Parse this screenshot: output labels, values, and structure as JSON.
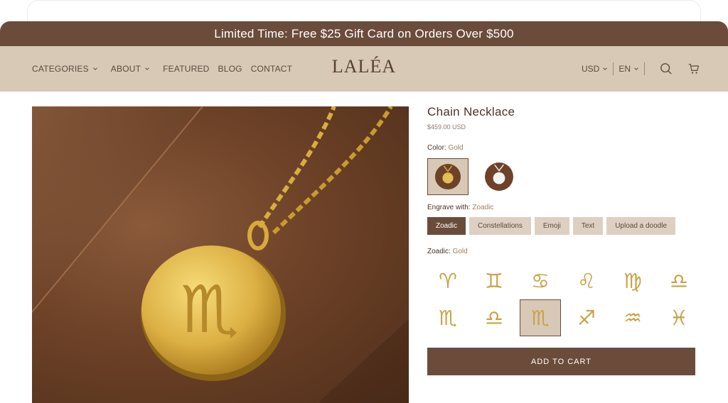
{
  "announcement": "Limited Time: Free $25 Gift Card on Orders Over $500",
  "nav": {
    "categories": "CATEGORIES",
    "about": "ABOUT",
    "featured": "FEATURED",
    "blog": "BLOG",
    "contact": "CONTACT"
  },
  "brand": "LALÉA",
  "currency": "USD",
  "language": "EN",
  "product": {
    "title": "Chain Necklace",
    "price": "$459.00 USD"
  },
  "color_option": {
    "label": "Color:",
    "value": "Gold"
  },
  "engrave_option": {
    "label": "Engrave with:",
    "value": "Zoadic",
    "choices": [
      "Zoadic",
      "Constellations",
      "Emoji",
      "Text",
      "Upload a doodle"
    ]
  },
  "zodiac_option": {
    "label": "Zoadic:",
    "value": "Gold",
    "symbols": [
      "♈",
      "♊",
      "♋",
      "♌",
      "♍",
      "♎",
      "♏",
      "♎",
      "♏",
      "♐",
      "♒",
      "♓"
    ]
  },
  "add_to_cart": "ADD TO CART",
  "colors": {
    "brand_brown": "#6b4c3b",
    "header_beige": "#d8c8b6",
    "gold": "#c9a248"
  },
  "icons": [
    "chevron-down-icon",
    "search-icon",
    "cart-icon"
  ]
}
